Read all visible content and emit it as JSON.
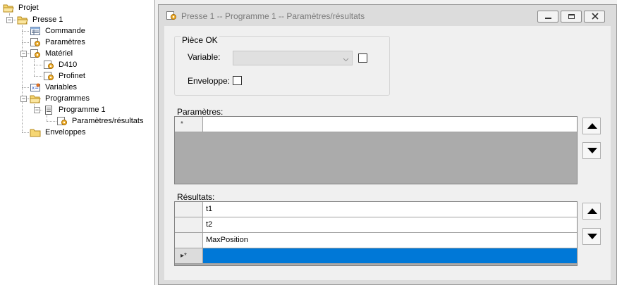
{
  "tree": {
    "root": "Projet",
    "presse": "Presse 1",
    "commande": "Commande",
    "parametres": "Paramètres",
    "materiel": "Matériel",
    "d410": "D410",
    "profinet": "Profinet",
    "variables": "Variables",
    "programmes": "Programmes",
    "programme1": "Programme 1",
    "param_resultats": "Paramètres/résultats",
    "enveloppes": "Enveloppes"
  },
  "window": {
    "title": "Presse 1 -- Programme 1 -- Paramètres/résultats"
  },
  "piece_ok": {
    "group_label": "Pièce OK",
    "variable_label": "Variable:",
    "variable_value": "",
    "variable_checked": false,
    "enveloppe_label": "Enveloppe:",
    "enveloppe_checked": false
  },
  "parametres": {
    "label": "Paramètres:",
    "new_row_marker": "*"
  },
  "resultats": {
    "label": "Résultats:",
    "rows": [
      "t1",
      "t2",
      "MaxPosition"
    ],
    "new_row_marker": "▸*"
  },
  "colors": {
    "selection": "#0078d7",
    "grid_background": "#ababab",
    "window_frame": "#dcdcdc"
  },
  "icons": {
    "folder": "folder-icon",
    "table": "table-icon",
    "settings": "settings-document-icon",
    "program": "program-document-icon",
    "variables": "variables-icon"
  }
}
